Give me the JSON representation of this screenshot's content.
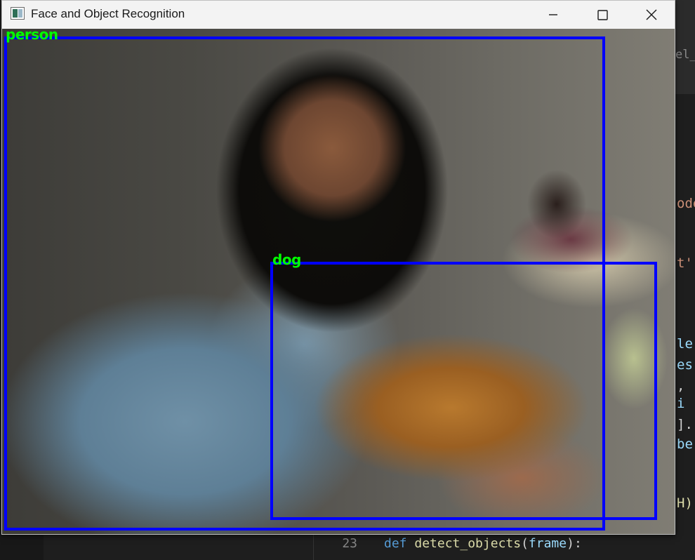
{
  "window": {
    "title": "Face and Object Recognition",
    "controls": {
      "minimize": "minimize-icon",
      "maximize": "maximize-icon",
      "close": "close-icon"
    }
  },
  "detections": [
    {
      "label": "person",
      "box_color": "#0000ff",
      "label_color": "#00ff00"
    },
    {
      "label": "dog",
      "box_color": "#0000ff",
      "label_color": "#00ff00"
    }
  ],
  "editor": {
    "tab_fragment": "el_m",
    "peek_lines": [
      "ode",
      "t'",
      "le",
      "es",
      ", ",
      "i ",
      "].",
      "be",
      "H)"
    ],
    "code": {
      "line_number": "23",
      "keyword": "def",
      "function": "detect_objects",
      "open": "(",
      "param": "frame",
      "close": "):"
    }
  }
}
